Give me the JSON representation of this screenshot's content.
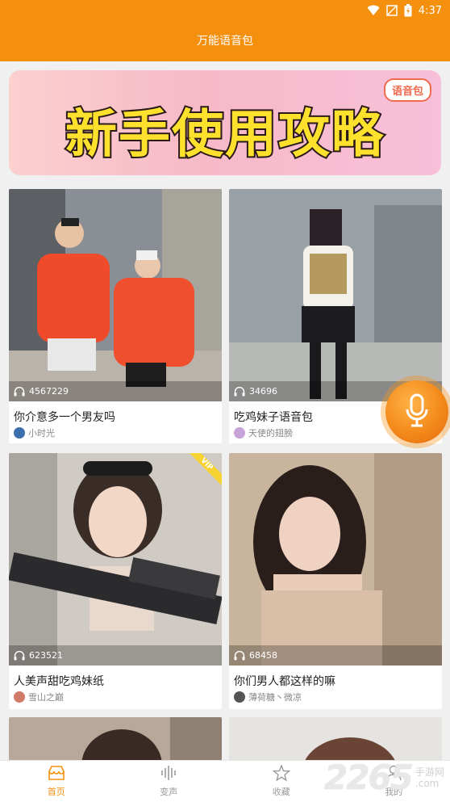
{
  "status": {
    "time": "4:37"
  },
  "header": {
    "title": "万能语音包"
  },
  "banner": {
    "text": "新手使用攻略",
    "tag": "语音包"
  },
  "cards": [
    {
      "title": "你介意多一个男友吗",
      "plays": "4567229",
      "author": "小时光"
    },
    {
      "title": "吃鸡妹子语音包",
      "plays": "34696",
      "author": "天使的翅膀"
    },
    {
      "title": "人美声甜吃鸡妹纸",
      "plays": "623521",
      "author": "雪山之巅",
      "badge": "VIP"
    },
    {
      "title": "你们男人都这样的嘛",
      "plays": "68458",
      "author": "薄荷糖丶微凉"
    }
  ],
  "tabs": [
    {
      "label": "首页"
    },
    {
      "label": "变声"
    },
    {
      "label": "收藏"
    },
    {
      "label": "我的"
    }
  ],
  "watermark": {
    "number": "2265",
    "site": "手游网",
    "domain": ".com"
  },
  "colors": {
    "accent": "#f5900f",
    "tab_inactive": "#9a9a9a"
  }
}
